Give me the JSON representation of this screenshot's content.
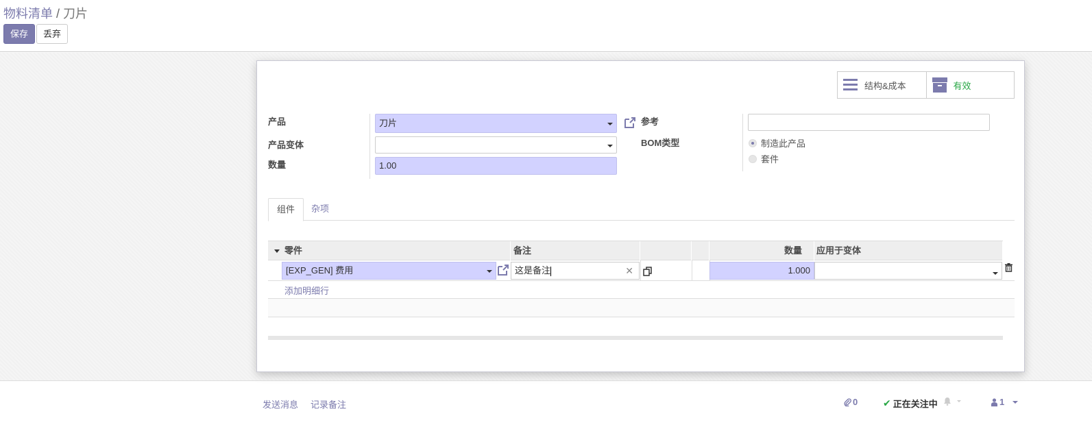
{
  "breadcrumb": {
    "parent": "物料清单",
    "separator": "/",
    "current": "刀片"
  },
  "toolbar": {
    "save_label": "保存",
    "discard_label": "丢弃"
  },
  "button_box": {
    "structure_cost_label": "结构&成本",
    "active_label": "有效"
  },
  "form": {
    "product_label": "产品",
    "product_value": "刀片",
    "variant_label": "产品变体",
    "variant_value": "",
    "quantity_label": "数量",
    "quantity_value": "1.00",
    "reference_label": "参考",
    "reference_value": "",
    "bom_type_label": "BOM类型",
    "bom_type_options": [
      {
        "label": "制造此产品",
        "selected": true
      },
      {
        "label": "套件",
        "selected": false
      }
    ]
  },
  "tabs": [
    {
      "label": "组件",
      "active": true
    },
    {
      "label": "杂项",
      "active": false
    }
  ],
  "components": {
    "headers": {
      "component": "零件",
      "note": "备注",
      "quantity": "数量",
      "variants": "应用于变体"
    },
    "rows": [
      {
        "component": "[EXP_GEN] 费用",
        "note": "这是备注",
        "quantity": "1.000",
        "variants": ""
      }
    ],
    "add_line_label": "添加明细行"
  },
  "chatter": {
    "send_message": "发送消息",
    "log_note": "记录备注",
    "attachments_count": "0",
    "following_label": "正在关注中",
    "followers_count": "1"
  },
  "colors": {
    "primary": "#7c7bad",
    "required_bg": "#d2d2ff",
    "active_green": "#28a745"
  }
}
